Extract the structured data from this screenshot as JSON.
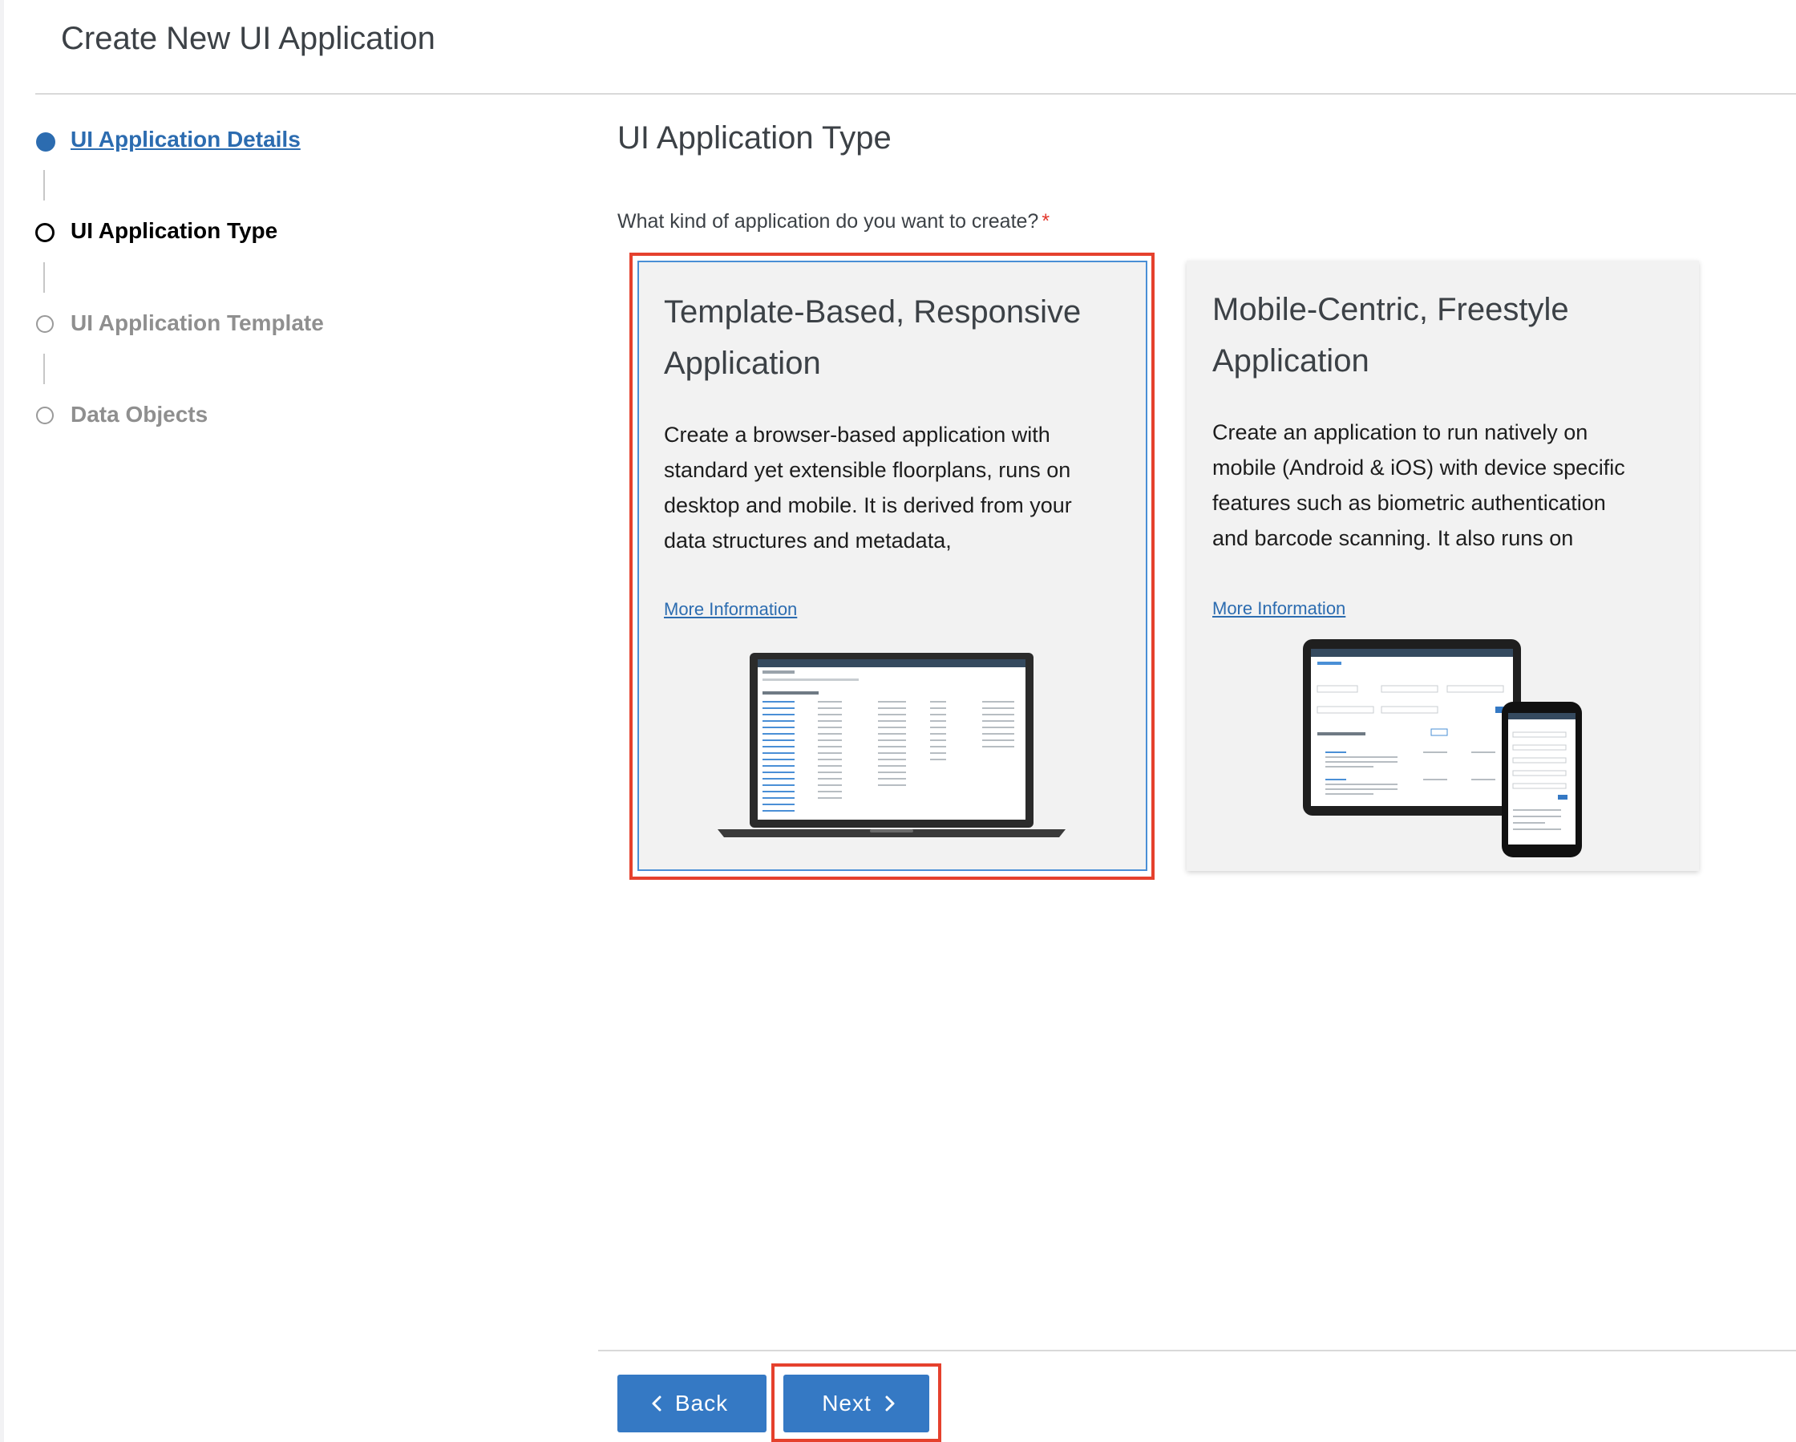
{
  "page": {
    "title": "Create New UI Application"
  },
  "stepper": {
    "steps": [
      {
        "label": "UI Application Details",
        "state": "completed"
      },
      {
        "label": "UI Application Type",
        "state": "current"
      },
      {
        "label": "UI Application Template",
        "state": "pending"
      },
      {
        "label": "Data Objects",
        "state": "pending"
      }
    ]
  },
  "main": {
    "section_title": "UI Application Type",
    "question": "What kind of application do you want to create?",
    "required_marker": "*",
    "cards": [
      {
        "title_line1": "Template-Based, Responsive",
        "title_line2": "Application",
        "desc_line1": "Create a browser-based application with",
        "desc_line2": "standard yet extensible floorplans, runs on",
        "desc_line3": "desktop and mobile. It is derived from your",
        "desc_line4": "data structures and metadata,",
        "link": "More Information",
        "selected": true,
        "illustration": "laptop-illustration"
      },
      {
        "title_line1": "Mobile-Centric, Freestyle",
        "title_line2": "Application",
        "desc_line1": "Create an application to run natively on",
        "desc_line2": "mobile (Android & iOS) with device specific",
        "desc_line3": "features such as biometric authentication",
        "desc_line4": "and barcode scanning. It also runs on",
        "link": "More Information",
        "selected": false,
        "illustration": "tablet-phone-illustration"
      }
    ]
  },
  "footer": {
    "back_label": "Back",
    "next_label": "Next"
  },
  "colors": {
    "accent": "#3579c4",
    "link": "#2c6cb0",
    "highlight": "#e5412d",
    "card_bg": "#f2f2f2"
  }
}
